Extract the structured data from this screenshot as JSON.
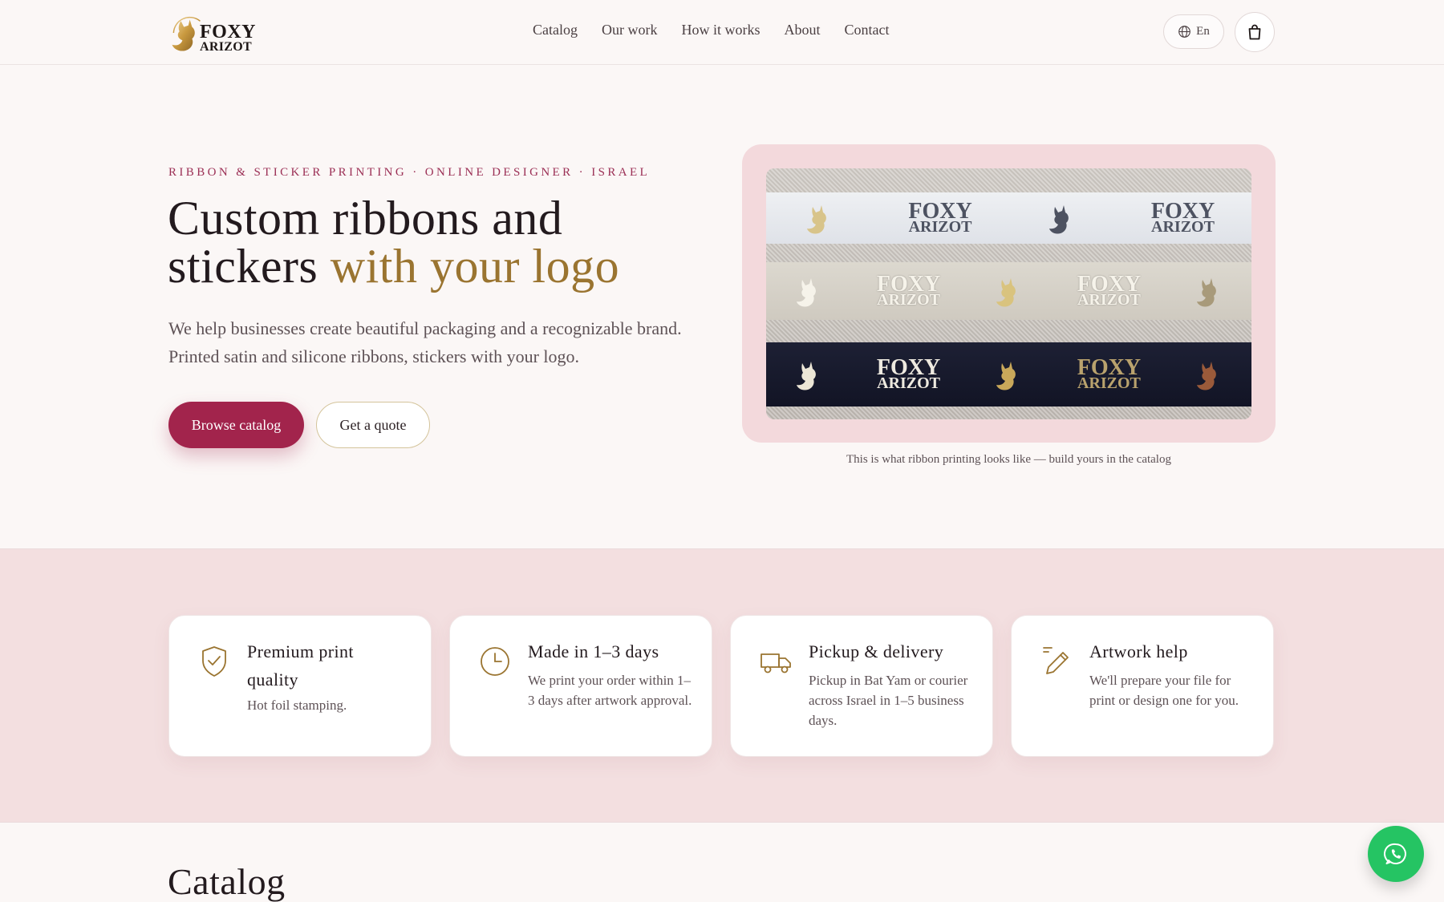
{
  "header": {
    "logo": {
      "line1": "FOXY",
      "line2": "ARIZOT"
    },
    "nav": [
      {
        "label": "Catalog"
      },
      {
        "label": "Our work"
      },
      {
        "label": "How it works"
      },
      {
        "label": "About"
      },
      {
        "label": "Contact"
      }
    ],
    "language": "En",
    "language_icon": "globe-icon",
    "cart_icon": "shopping-bag-icon"
  },
  "hero": {
    "eyebrow": "RIBBON & STICKER PRINTING · ONLINE DESIGNER · ISRAEL",
    "title_line1": "Custom ribbons and",
    "title_line2_start": "stickers ",
    "title_line2_accent": "with your logo",
    "description": "We help businesses create beautiful packaging and a recognizable brand. Printed satin and silicone ribbons, stickers with your logo.",
    "primary_button": "Browse catalog",
    "secondary_button": "Get a quote",
    "image_ribbon_text": {
      "line1": "FOXY",
      "line2": "ARIZOT"
    },
    "caption": "This is what ribbon printing looks like — build yours in the catalog"
  },
  "features": [
    {
      "icon": "shield-check-icon",
      "title": "Premium print quality",
      "text": "Hot foil stamping."
    },
    {
      "icon": "clock-icon",
      "title": "Made in 1–3 days",
      "text": "We print your order within 1–3 days after artwork approval."
    },
    {
      "icon": "truck-icon",
      "title": "Pickup & delivery",
      "text": "Pickup in Bat Yam or courier across Israel in 1–5 business days."
    },
    {
      "icon": "pencil-icon",
      "title": "Artwork help",
      "text": "We'll prepare your file for print or design one for you."
    }
  ],
  "catalog": {
    "title": "Catalog"
  },
  "floating": {
    "icon": "whatsapp-icon"
  },
  "colors": {
    "accent": "#a2244c",
    "gold": "#9a7430",
    "background": "#fbf7f6",
    "features_band": "#f3dfe0",
    "whatsapp": "#25c463"
  }
}
